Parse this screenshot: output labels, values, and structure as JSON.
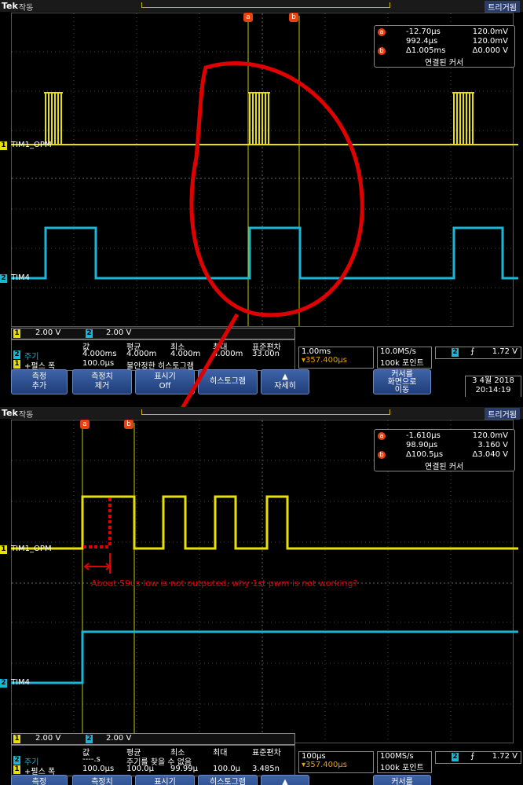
{
  "top": {
    "status": {
      "brand": "Tek",
      "run": "작동",
      "trigger": "트리거됨"
    },
    "cursor_tags": [
      "a",
      "b"
    ],
    "channels": {
      "ch1_num": "1",
      "ch1_label": "TIM1_OPM",
      "ch2_num": "2",
      "ch2_label": "TIM4"
    },
    "readout": {
      "a_mark": "a",
      "a_time": "-12.70µs",
      "a_volt": "120.0mV",
      "b_time_abs": "992.4µs",
      "b_volt_abs": "120.0mV",
      "b_mark": "b",
      "delta_time": "Δ1.005ms",
      "delta_volt": "Δ0.000 V",
      "link": "연결된 커서"
    },
    "scale": {
      "ch1": "2.00 V",
      "ch2": "2.00 V"
    },
    "meas": {
      "hdr_value": "값",
      "hdr_mean": "평균",
      "hdr_min": "최소",
      "hdr_max": "최대",
      "hdr_std": "표준편차",
      "r1_ch": "2",
      "r1_name": "주기",
      "r1_value": "4.000ms",
      "r1_mean": "4.000m",
      "r1_min": "4.000m",
      "r1_max": "4.000m",
      "r1_std": "33.00n",
      "r2_ch": "1",
      "r2_name": "+펄스 폭",
      "r2_value": "100.0µs",
      "r2_text": "불안정한 히스토그램"
    },
    "horizontal": {
      "timebase": "1.00ms",
      "delay": "▾357.400µs"
    },
    "acq": {
      "rate": "10.0MS/s",
      "points": "100k 포인트"
    },
    "trig": {
      "ch": "2",
      "slope": "⨍",
      "level": "1.72 V"
    },
    "buttons": {
      "b1": "측정\n추가",
      "b2": "측정치\n제거",
      "b3": "표시기",
      "b3_val": "Off",
      "b4": "히스토그램",
      "b5": "자세히",
      "b6": "커서를\n화면으로\n이동"
    },
    "date": {
      "day": "3 4월 2018",
      "time": "20:14:19"
    }
  },
  "bottom": {
    "status": {
      "brand": "Tek",
      "run": "작동",
      "trigger": "트리거됨"
    },
    "cursor_tags": [
      "a",
      "b"
    ],
    "channels": {
      "ch1_num": "1",
      "ch1_label": "TIM1_OPM",
      "ch2_num": "2",
      "ch2_label": "TIM4"
    },
    "readout": {
      "a_mark": "a",
      "a_time": "-1.610µs",
      "a_volt": "120.0mV",
      "b_time_abs": "98.90µs",
      "b_volt_abs": "3.160 V",
      "b_mark": "b",
      "delta_time": "Δ100.5µs",
      "delta_volt": "Δ3.040 V",
      "link": "연결된 커서"
    },
    "annotation": "About 59us low is not outputed, why 1st pwm is not working?",
    "scale": {
      "ch1": "2.00 V",
      "ch2": "2.00 V"
    },
    "meas": {
      "hdr_value": "값",
      "hdr_mean": "평균",
      "hdr_min": "최소",
      "hdr_max": "최대",
      "hdr_std": "표준편차",
      "r1_ch": "2",
      "r1_name": "주기",
      "r1_value": "----.s",
      "r1_text": "주기를 찾을 수 없음",
      "r2_ch": "1",
      "r2_name": "+펄스 폭",
      "r2_value": "100.0µs",
      "r2_mean": "100.0µ",
      "r2_min": "99.99µ",
      "r2_max": "100.0µ",
      "r2_std": "3.485n"
    },
    "horizontal": {
      "timebase": "100µs",
      "delay": "▾357.400µs"
    },
    "acq": {
      "rate": "100MS/s",
      "points": "100k 포인트"
    },
    "trig": {
      "ch": "2",
      "slope": "⨍",
      "level": "1.72 V"
    },
    "buttons": {
      "b1": "측정",
      "b2": "측정치",
      "b3": "표시기",
      "b4": "히스토그램",
      "b6": "커서를"
    }
  },
  "colors": {
    "ch1": "#e8e000",
    "ch2": "#1ab6d6",
    "cursor": "#e84010",
    "annotation": "#e00000"
  }
}
